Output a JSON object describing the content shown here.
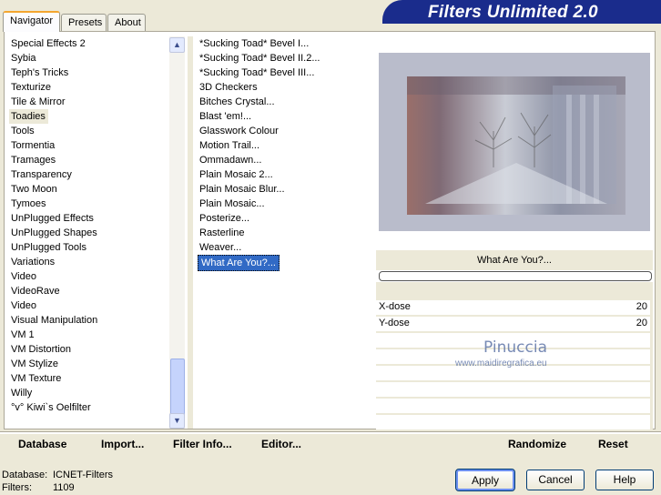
{
  "tabs": [
    {
      "label": "Navigator"
    },
    {
      "label": "Presets"
    },
    {
      "label": "About"
    }
  ],
  "banner": {
    "title": "Filters Unlimited 2.0"
  },
  "categories": [
    "Special Effects 2",
    "Sybia",
    "Teph's Tricks",
    "Texturize",
    "Tile & Mirror",
    "Toadies",
    "Tools",
    "Tormentia",
    "Tramages",
    "Transparency",
    "Two Moon",
    "Tymoes",
    "UnPlugged Effects",
    "UnPlugged Shapes",
    "UnPlugged Tools",
    "Variations",
    "Video",
    "VideoRave",
    "Video",
    "Visual Manipulation",
    "VM 1",
    "VM Distortion",
    "VM Stylize",
    "VM Texture",
    "Willy",
    "°v° Kiwi`s Oelfilter"
  ],
  "selected_category": "Toadies",
  "filters": [
    "*Sucking Toad*  Bevel I...",
    "*Sucking Toad*  Bevel II.2...",
    "*Sucking Toad*  Bevel III...",
    "3D Checkers",
    "Bitches Crystal...",
    "Blast 'em!...",
    "Glasswork Colour",
    "Motion Trail...",
    "Ommadawn...",
    "Plain Mosaic 2...",
    "Plain Mosaic Blur...",
    "Plain Mosaic...",
    "Posterize...",
    "Rasterline",
    "Weaver...",
    "What Are You?..."
  ],
  "selected_filter": "What Are You?...",
  "filter_name_display": "What Are You?...",
  "params": [
    {
      "label": "X-dose",
      "value": "20"
    },
    {
      "label": "Y-dose",
      "value": "20"
    }
  ],
  "watermark": {
    "name": "Pinuccia",
    "url": "www.maidiregrafica.eu"
  },
  "bottom_links": {
    "database": "Database",
    "import": "Import...",
    "filter_info": "Filter Info...",
    "editor": "Editor...",
    "randomize": "Randomize",
    "reset": "Reset"
  },
  "status": {
    "db_label": "Database:",
    "db_value": "ICNET-Filters",
    "filters_label": "Filters:",
    "filters_value": "1109"
  },
  "buttons": {
    "apply": "Apply",
    "cancel": "Cancel",
    "help": "Help"
  },
  "colors": {
    "banner": "#1a2c8c",
    "selection": "#316ac5",
    "tab_accent": "#f4a62f"
  }
}
